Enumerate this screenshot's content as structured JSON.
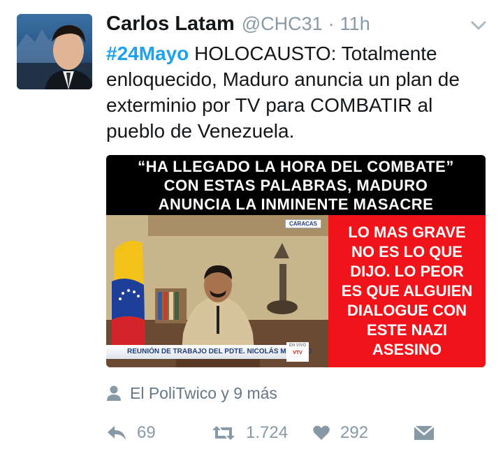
{
  "tweet": {
    "author_name": "Carlos Latam",
    "author_handle": "@CHC31",
    "separator": "·",
    "time": "11h",
    "hashtag": "#24Mayo",
    "text": " HOLOCAUSTO: Totalmente enloquecido, Maduro anuncia un plan de exterminio por TV para COMBATIR al pueblo de Venezuela."
  },
  "media": {
    "headline_lines": [
      "“HA LLEGADO LA HORA DEL COMBATE”",
      "CON ESTAS PALABRAS, MADURO",
      "ANUNCIA LA INMINENTE MASACRE"
    ],
    "side_lines": [
      "LO MAS GRAVE",
      "NO ES LO QUE",
      "DIJO. LO PEOR",
      "ES QUE ALGUIEN",
      "DIALOGUE CON",
      "ESTE NAZI",
      "ASESINO"
    ],
    "tv_tag": "CARACAS",
    "tv_caption": "REUNIÓN DE TRABAJO DEL PDTE. NICOLÁS MADURO",
    "tv_logo": "VTV",
    "colors": {
      "headline_bg": "#000000",
      "side_bg": "#f0141a",
      "text": "#ffffff"
    }
  },
  "social_context": {
    "icon": "person-icon",
    "text": "El PoliTwico y 9 más"
  },
  "actions": {
    "reply_count": "69",
    "retweet_count": "1.724",
    "like_count": "292"
  },
  "colors": {
    "hashtag": "#1da1f2",
    "muted": "#8899a6",
    "text": "#14171a"
  }
}
